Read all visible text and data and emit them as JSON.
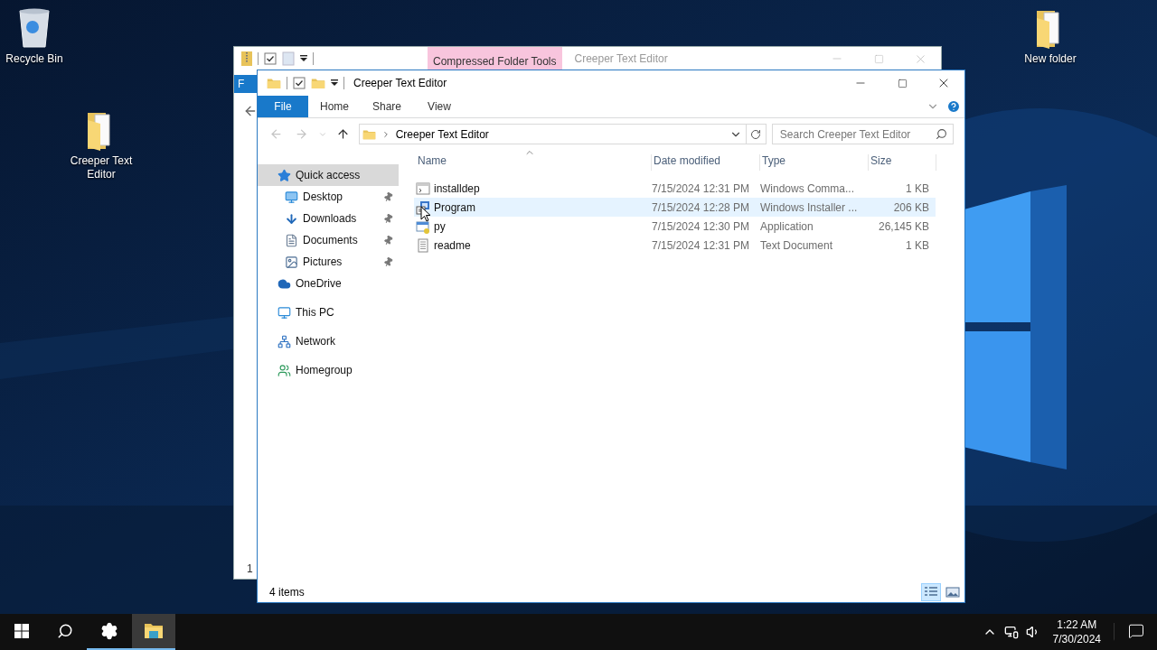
{
  "desktop_icons": [
    {
      "label": "Recycle Bin"
    },
    {
      "label": "Creeper Text Editor"
    },
    {
      "label": "New folder"
    }
  ],
  "back_window": {
    "title": "Creeper Text Editor",
    "contextual_tab": "Compressed Folder Tools",
    "ribbon_tab": "F",
    "status": "1"
  },
  "main_window": {
    "title": "Creeper Text Editor",
    "ribbon_tabs": [
      {
        "label": "File",
        "kind": "file"
      },
      {
        "label": "Home",
        "kind": "tab"
      },
      {
        "label": "Share",
        "kind": "tab"
      },
      {
        "label": "View",
        "kind": "tab"
      }
    ],
    "address": "Creeper Text Editor",
    "search": {
      "placeholder": "Search Creeper Text Editor"
    },
    "nav": [
      {
        "label": "Quick access",
        "selected": true,
        "children": [
          {
            "label": "Desktop",
            "pinned": true,
            "selected": false
          },
          {
            "label": "Downloads",
            "pinned": true,
            "selected": false
          },
          {
            "label": "Documents",
            "pinned": true,
            "selected": false
          },
          {
            "label": "Pictures",
            "pinned": true,
            "selected": false
          }
        ]
      },
      {
        "label": "OneDrive",
        "selected": false
      },
      {
        "label": "This PC",
        "selected": false
      },
      {
        "label": "Network",
        "selected": false
      },
      {
        "label": "Homegroup",
        "selected": false
      }
    ],
    "columns": [
      "Name",
      "Date modified",
      "Type",
      "Size"
    ],
    "rows": [
      {
        "name": "installdep",
        "date": "7/15/2024 12:31 PM",
        "type": "Windows Comma...",
        "size": "1 KB",
        "highlighted": false
      },
      {
        "name": "Program",
        "date": "7/15/2024 12:28 PM",
        "type": "Windows Installer ...",
        "size": "206 KB",
        "highlighted": true
      },
      {
        "name": "py",
        "date": "7/15/2024 12:30 PM",
        "type": "Application",
        "size": "26,145 KB",
        "highlighted": false
      },
      {
        "name": "readme",
        "date": "7/15/2024 12:31 PM",
        "type": "Text Document",
        "size": "1 KB",
        "highlighted": false
      }
    ],
    "status": "4 items",
    "views": [
      {
        "selected": true
      },
      {
        "selected": false
      }
    ]
  },
  "taskbar": {
    "apps": [
      {
        "running": false,
        "active": false
      },
      {
        "running": false,
        "active": false
      },
      {
        "running": true,
        "active": false
      },
      {
        "running": true,
        "active": true
      }
    ],
    "time": "1:22 AM",
    "date": "7/30/2024"
  }
}
